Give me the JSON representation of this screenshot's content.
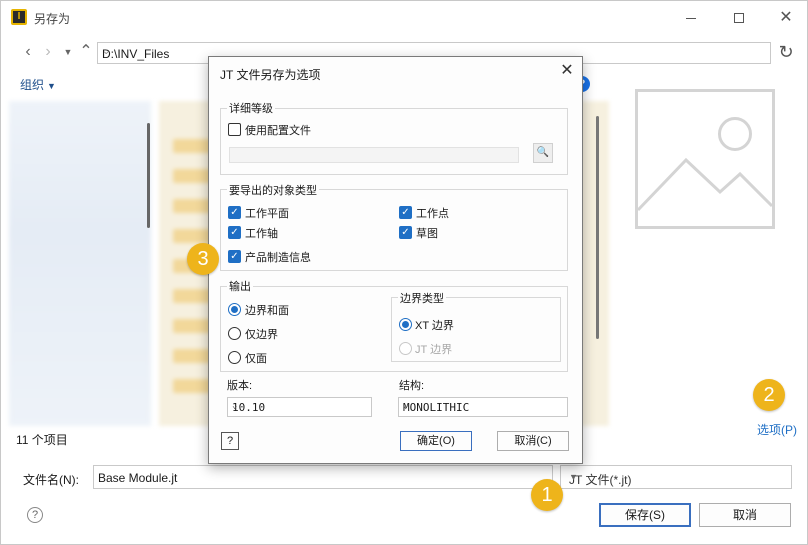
{
  "window": {
    "title": "另存为",
    "app_icon_label": "I"
  },
  "address": {
    "path": "D:\\INV_Files"
  },
  "toolbar": {
    "organize_label": "组织"
  },
  "status": {
    "item_count": "11 个项目"
  },
  "options_link": "选项(P)",
  "filename": {
    "label": "文件名(N):",
    "value": "Base Module.jt"
  },
  "filetype": {
    "value": "JT 文件(*.jt)"
  },
  "buttons": {
    "save": "保存(S)",
    "cancel": "取消"
  },
  "badges": [
    "1",
    "2",
    "3"
  ],
  "dialog": {
    "title": "JT 文件另存为选项",
    "detail_group": {
      "label": "详细等级",
      "use_config_label": "使用配置文件",
      "use_config_checked": false
    },
    "objects_group": {
      "label": "要导出的对象类型",
      "items": [
        {
          "label": "工作平面",
          "checked": true
        },
        {
          "label": "工作点",
          "checked": true
        },
        {
          "label": "工作轴",
          "checked": true
        },
        {
          "label": "草图",
          "checked": true
        },
        {
          "label": "产品制造信息",
          "checked": true
        }
      ]
    },
    "output_group": {
      "label": "输出",
      "options": [
        {
          "label": "边界和面",
          "selected": true
        },
        {
          "label": "仅边界",
          "selected": false
        },
        {
          "label": "仅面",
          "selected": false
        }
      ],
      "boundary_group": {
        "label": "边界类型",
        "options": [
          {
            "label": "XT 边界",
            "selected": true,
            "enabled": true
          },
          {
            "label": "JT 边界",
            "selected": false,
            "enabled": false
          }
        ]
      }
    },
    "version": {
      "label": "版本:",
      "value": "10.10"
    },
    "structure": {
      "label": "结构:",
      "value": "MONOLITHIC"
    },
    "help_label": "?",
    "ok_label": "确定(O)",
    "cancel_label": "取消(C)"
  },
  "colors": {
    "accent": "#1f6fc5",
    "badge": "#eeb41b"
  }
}
